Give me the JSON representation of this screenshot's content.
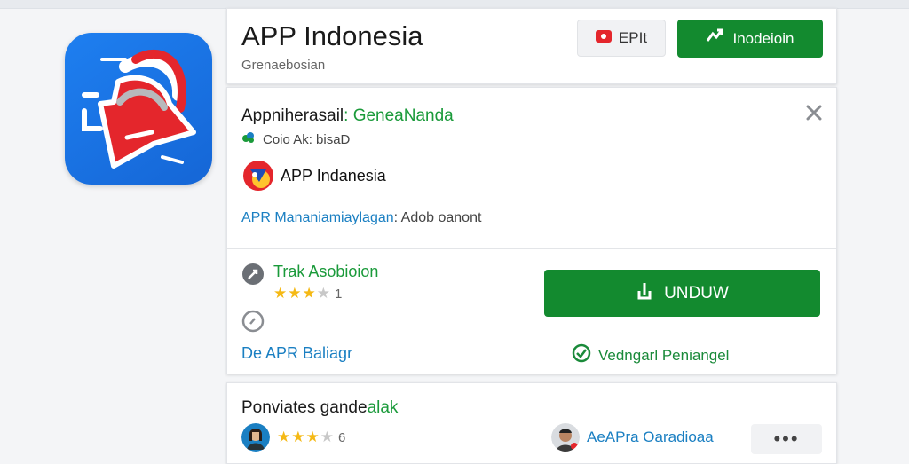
{
  "header": {
    "app_title": "APP Indonesia",
    "subtitle": "Grenaebosian",
    "edit_label": "EPIt",
    "install_label": "Inodeioin"
  },
  "info": {
    "title_main": "Appniherasail",
    "title_accent": ": GeneaNanda",
    "developer": "Coio Ak: bisaD",
    "app_name": "APP Indanesia",
    "permission_link": "APR Mananiamiaylagan",
    "permission_rest": ": Adob oanont"
  },
  "version": {
    "label": "Trak Asobioion",
    "rating": 3,
    "rating_count": "1"
  },
  "actions": {
    "detail_link": "De APR Baliagr",
    "download_label": "UNDUW",
    "verified_label": "Vedngarl Peniangel"
  },
  "reviews": {
    "title_main": "Ponviates gande",
    "title_accent": "alak",
    "review1_rating": 3,
    "review1_count": "6",
    "review2_name": "AeAPra Oaradioaa",
    "more_label": "•••"
  },
  "colors": {
    "brand_blue": "#1e7ff0",
    "install_green": "#138a2f",
    "accent_green": "#1a9a3a",
    "link_blue": "#1a7fc2",
    "star_yellow": "#f5b915"
  },
  "icons": [
    "app-logo-icon",
    "edit-icon",
    "download-arrow-icon",
    "close-icon",
    "dev-leaf-icon",
    "history-icon",
    "info-circle-icon",
    "check-circle-icon",
    "more-icon"
  ]
}
